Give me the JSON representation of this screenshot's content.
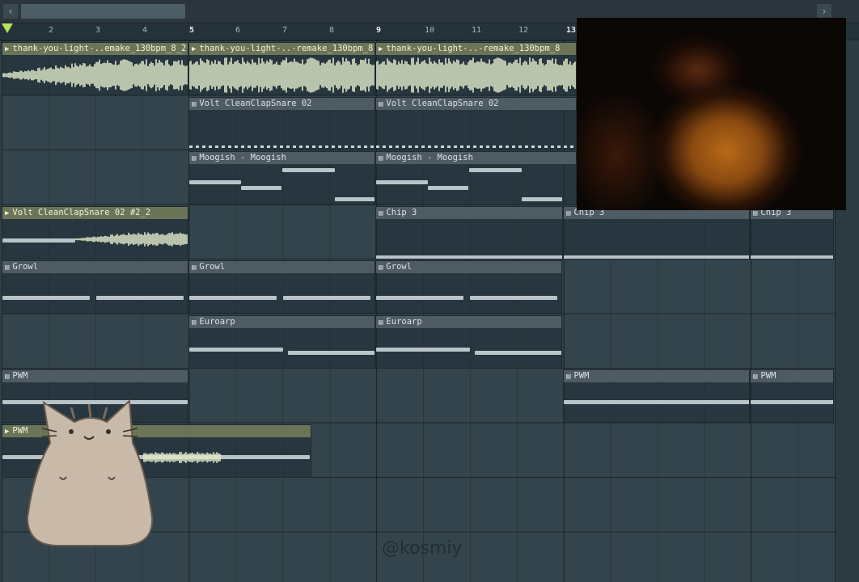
{
  "timeline": {
    "bar_numbers": [
      "2",
      "3",
      "4",
      "5",
      "6",
      "7",
      "8",
      "9",
      "10",
      "11",
      "12",
      "13"
    ],
    "major_bars": [
      "5",
      "9",
      "13"
    ],
    "scroll_left": "‹",
    "scroll_right": "›"
  },
  "clips": [
    {
      "label": "thank-you-light-..emake_130bpm_8_2",
      "kind": "audio"
    },
    {
      "label": "thank-you-light-..-remake_130bpm_8",
      "kind": "audio"
    },
    {
      "label": "thank-you-light-..-remake_130bpm_8",
      "kind": "audio"
    },
    {
      "label": "Volt CleanClapSnare 02",
      "kind": "pattern"
    },
    {
      "label": "Volt CleanClapSnare 02",
      "kind": "pattern"
    },
    {
      "label": "Moogish - Moogish",
      "kind": "pattern"
    },
    {
      "label": "Moogish - Moogish",
      "kind": "pattern"
    },
    {
      "label": "Volt CleanClapSnare 02 #2_2",
      "kind": "audio"
    },
    {
      "label": "Chip 3",
      "kind": "pattern"
    },
    {
      "label": "Chip 3",
      "kind": "pattern"
    },
    {
      "label": "Chip 3",
      "kind": "pattern"
    },
    {
      "label": "Growl",
      "kind": "pattern"
    },
    {
      "label": "Growl",
      "kind": "pattern"
    },
    {
      "label": "Growl",
      "kind": "pattern"
    },
    {
      "label": "Euroarp",
      "kind": "pattern"
    },
    {
      "label": "Euroarp",
      "kind": "pattern"
    },
    {
      "label": "PWM",
      "kind": "pattern"
    },
    {
      "label": "PWM",
      "kind": "pattern"
    },
    {
      "label": "PWM",
      "kind": "pattern"
    },
    {
      "label": "PWM",
      "kind": "audio"
    }
  ],
  "icons": {
    "audio_clip": "play-arrow-icon",
    "pattern_clip": "pattern-grid-icon"
  },
  "colors": {
    "grid": "#33444c",
    "clip_header": "#4f5b62",
    "audio_header": "#6c7457",
    "waveform": "#dfe8c8"
  },
  "overlay": {
    "watermark": "@kosmiy"
  }
}
